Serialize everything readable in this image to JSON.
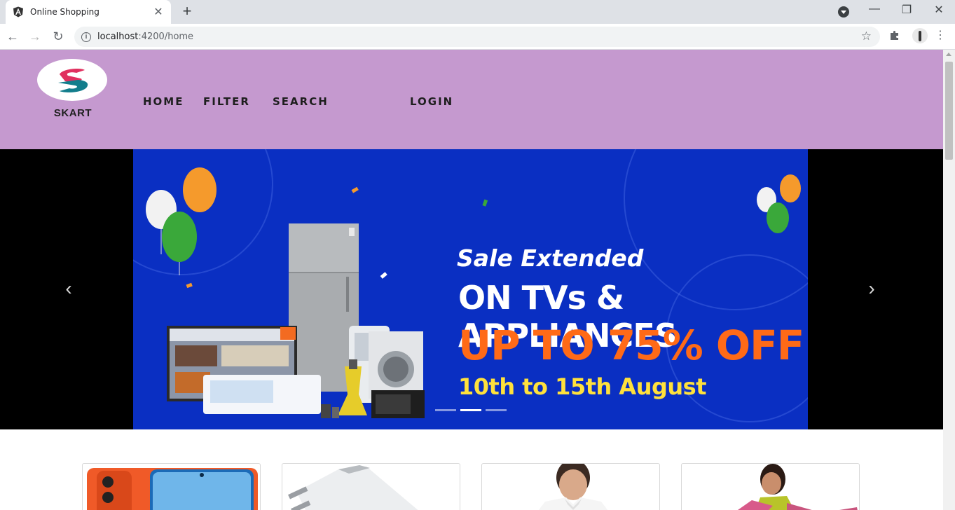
{
  "browser": {
    "tab_title": "Online Shopping",
    "url_host": "localhost",
    "url_path": ":4200/home"
  },
  "site": {
    "logo_text": "SKART",
    "nav": [
      {
        "label": "HOME"
      },
      {
        "label": "FILTER"
      },
      {
        "label": "SEARCH"
      },
      {
        "label": "LOGIN"
      }
    ]
  },
  "carousel": {
    "slide": {
      "tagline": "Sale Extended",
      "headline": "ON TVs & APPLIANCES",
      "offer": "UP TO 75% OFF",
      "dates": "10th to 15th August"
    },
    "indicator_count": 3,
    "active_indicator": 2
  },
  "colors": {
    "header_bg": "#c599cf",
    "slide_bg": "#0a2fc2",
    "offer_text": "#ff6a17",
    "dates_text": "#ffe13c"
  }
}
